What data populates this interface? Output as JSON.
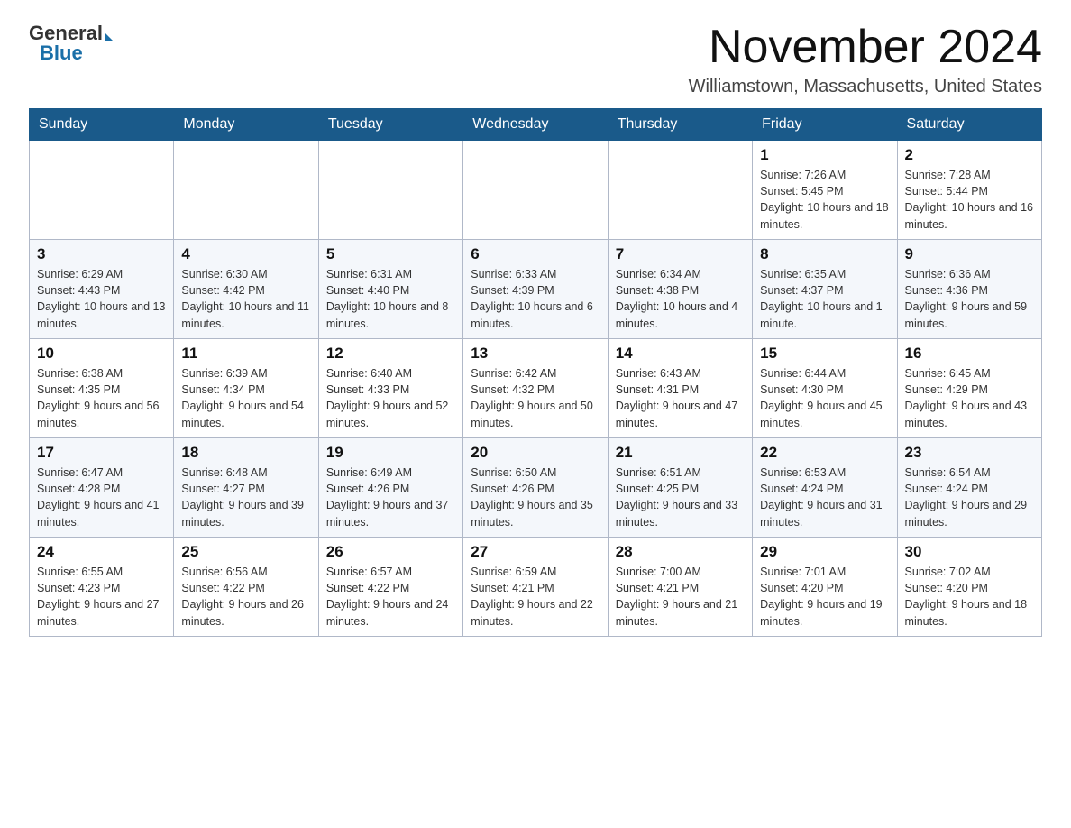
{
  "header": {
    "logo_general": "General",
    "logo_blue": "Blue",
    "month_title": "November 2024",
    "location": "Williamstown, Massachusetts, United States"
  },
  "days_of_week": [
    "Sunday",
    "Monday",
    "Tuesday",
    "Wednesday",
    "Thursday",
    "Friday",
    "Saturday"
  ],
  "weeks": [
    [
      {
        "day": "",
        "info": ""
      },
      {
        "day": "",
        "info": ""
      },
      {
        "day": "",
        "info": ""
      },
      {
        "day": "",
        "info": ""
      },
      {
        "day": "",
        "info": ""
      },
      {
        "day": "1",
        "info": "Sunrise: 7:26 AM\nSunset: 5:45 PM\nDaylight: 10 hours and 18 minutes."
      },
      {
        "day": "2",
        "info": "Sunrise: 7:28 AM\nSunset: 5:44 PM\nDaylight: 10 hours and 16 minutes."
      }
    ],
    [
      {
        "day": "3",
        "info": "Sunrise: 6:29 AM\nSunset: 4:43 PM\nDaylight: 10 hours and 13 minutes."
      },
      {
        "day": "4",
        "info": "Sunrise: 6:30 AM\nSunset: 4:42 PM\nDaylight: 10 hours and 11 minutes."
      },
      {
        "day": "5",
        "info": "Sunrise: 6:31 AM\nSunset: 4:40 PM\nDaylight: 10 hours and 8 minutes."
      },
      {
        "day": "6",
        "info": "Sunrise: 6:33 AM\nSunset: 4:39 PM\nDaylight: 10 hours and 6 minutes."
      },
      {
        "day": "7",
        "info": "Sunrise: 6:34 AM\nSunset: 4:38 PM\nDaylight: 10 hours and 4 minutes."
      },
      {
        "day": "8",
        "info": "Sunrise: 6:35 AM\nSunset: 4:37 PM\nDaylight: 10 hours and 1 minute."
      },
      {
        "day": "9",
        "info": "Sunrise: 6:36 AM\nSunset: 4:36 PM\nDaylight: 9 hours and 59 minutes."
      }
    ],
    [
      {
        "day": "10",
        "info": "Sunrise: 6:38 AM\nSunset: 4:35 PM\nDaylight: 9 hours and 56 minutes."
      },
      {
        "day": "11",
        "info": "Sunrise: 6:39 AM\nSunset: 4:34 PM\nDaylight: 9 hours and 54 minutes."
      },
      {
        "day": "12",
        "info": "Sunrise: 6:40 AM\nSunset: 4:33 PM\nDaylight: 9 hours and 52 minutes."
      },
      {
        "day": "13",
        "info": "Sunrise: 6:42 AM\nSunset: 4:32 PM\nDaylight: 9 hours and 50 minutes."
      },
      {
        "day": "14",
        "info": "Sunrise: 6:43 AM\nSunset: 4:31 PM\nDaylight: 9 hours and 47 minutes."
      },
      {
        "day": "15",
        "info": "Sunrise: 6:44 AM\nSunset: 4:30 PM\nDaylight: 9 hours and 45 minutes."
      },
      {
        "day": "16",
        "info": "Sunrise: 6:45 AM\nSunset: 4:29 PM\nDaylight: 9 hours and 43 minutes."
      }
    ],
    [
      {
        "day": "17",
        "info": "Sunrise: 6:47 AM\nSunset: 4:28 PM\nDaylight: 9 hours and 41 minutes."
      },
      {
        "day": "18",
        "info": "Sunrise: 6:48 AM\nSunset: 4:27 PM\nDaylight: 9 hours and 39 minutes."
      },
      {
        "day": "19",
        "info": "Sunrise: 6:49 AM\nSunset: 4:26 PM\nDaylight: 9 hours and 37 minutes."
      },
      {
        "day": "20",
        "info": "Sunrise: 6:50 AM\nSunset: 4:26 PM\nDaylight: 9 hours and 35 minutes."
      },
      {
        "day": "21",
        "info": "Sunrise: 6:51 AM\nSunset: 4:25 PM\nDaylight: 9 hours and 33 minutes."
      },
      {
        "day": "22",
        "info": "Sunrise: 6:53 AM\nSunset: 4:24 PM\nDaylight: 9 hours and 31 minutes."
      },
      {
        "day": "23",
        "info": "Sunrise: 6:54 AM\nSunset: 4:24 PM\nDaylight: 9 hours and 29 minutes."
      }
    ],
    [
      {
        "day": "24",
        "info": "Sunrise: 6:55 AM\nSunset: 4:23 PM\nDaylight: 9 hours and 27 minutes."
      },
      {
        "day": "25",
        "info": "Sunrise: 6:56 AM\nSunset: 4:22 PM\nDaylight: 9 hours and 26 minutes."
      },
      {
        "day": "26",
        "info": "Sunrise: 6:57 AM\nSunset: 4:22 PM\nDaylight: 9 hours and 24 minutes."
      },
      {
        "day": "27",
        "info": "Sunrise: 6:59 AM\nSunset: 4:21 PM\nDaylight: 9 hours and 22 minutes."
      },
      {
        "day": "28",
        "info": "Sunrise: 7:00 AM\nSunset: 4:21 PM\nDaylight: 9 hours and 21 minutes."
      },
      {
        "day": "29",
        "info": "Sunrise: 7:01 AM\nSunset: 4:20 PM\nDaylight: 9 hours and 19 minutes."
      },
      {
        "day": "30",
        "info": "Sunrise: 7:02 AM\nSunset: 4:20 PM\nDaylight: 9 hours and 18 minutes."
      }
    ]
  ]
}
